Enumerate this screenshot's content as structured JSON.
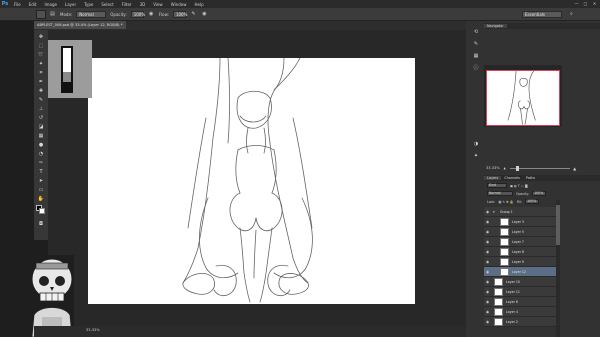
{
  "app": {
    "logo": "Ps"
  },
  "menu": [
    "File",
    "Edit",
    "Image",
    "Layer",
    "Type",
    "Select",
    "Filter",
    "3D",
    "View",
    "Window",
    "Help"
  ],
  "window_controls": [
    "—",
    "□",
    "✕"
  ],
  "options": {
    "mode_label": "Mode:",
    "mode_value": "Normal",
    "opacity_label": "Opacity:",
    "opacity_value": "100%",
    "flow_label": "Flow:",
    "flow_value": "100%",
    "workspace": "Essentials"
  },
  "document": {
    "tab_title": "ABPLEST_006.psd @ 33.4% (Layer 12, RGB/8) *"
  },
  "status": {
    "zoom": "33.33%"
  },
  "panels": {
    "top_tabs": [
      "Navigator"
    ],
    "navigator_zoom": "33.33%",
    "layer_tabs": [
      "Layers",
      "Channels",
      "Paths"
    ],
    "kind_label": "Kind",
    "blend_mode": "Normal",
    "opacity_label": "Opacity:",
    "opacity_value": "100%",
    "lock_label": "Lock:",
    "fill_label": "Fill:",
    "fill_value": "100%"
  },
  "layers": [
    {
      "name": "Group 1",
      "selected": false,
      "group": true
    },
    {
      "name": "Layer 3",
      "selected": false
    },
    {
      "name": "Layer 5",
      "selected": false
    },
    {
      "name": "Layer 7",
      "selected": false
    },
    {
      "name": "Layer 8",
      "selected": false
    },
    {
      "name": "Layer 9",
      "selected": false
    },
    {
      "name": "Layer 12",
      "selected": true
    },
    {
      "name": "Layer 10",
      "selected": false
    },
    {
      "name": "Layer 11",
      "selected": false
    },
    {
      "name": "Layer 6",
      "selected": false
    },
    {
      "name": "Layer 4",
      "selected": false
    },
    {
      "name": "Layer 2",
      "selected": false
    }
  ],
  "colors": {
    "accent": "#d9415b",
    "selected_layer": "#5b6e86",
    "foreground": "#000000",
    "background": "#ffffff"
  }
}
